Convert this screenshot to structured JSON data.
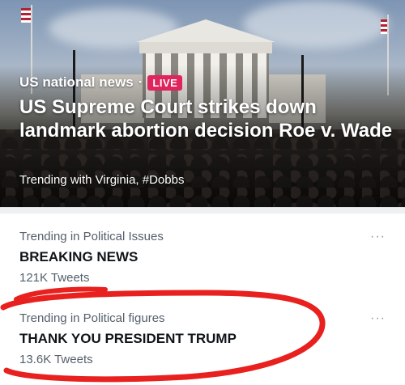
{
  "hero": {
    "category": "US national news",
    "separator": "·",
    "live_badge": "LIVE",
    "headline": "US Supreme Court strikes down landmark abortion decision Roe v. Wade",
    "subtitle": "Trending with Virginia, #Dobbs"
  },
  "trends": [
    {
      "context": "Trending in Political Issues",
      "title": "BREAKING NEWS",
      "count": "121K Tweets",
      "more": "···"
    },
    {
      "context": "Trending in Political figures",
      "title": "THANK YOU PRESIDENT TRUMP",
      "count": "13.6K Tweets",
      "more": "···"
    }
  ],
  "colors": {
    "live_badge": "#e0245e",
    "annotation_circle": "#e8211f",
    "secondary_text": "#55606b"
  }
}
